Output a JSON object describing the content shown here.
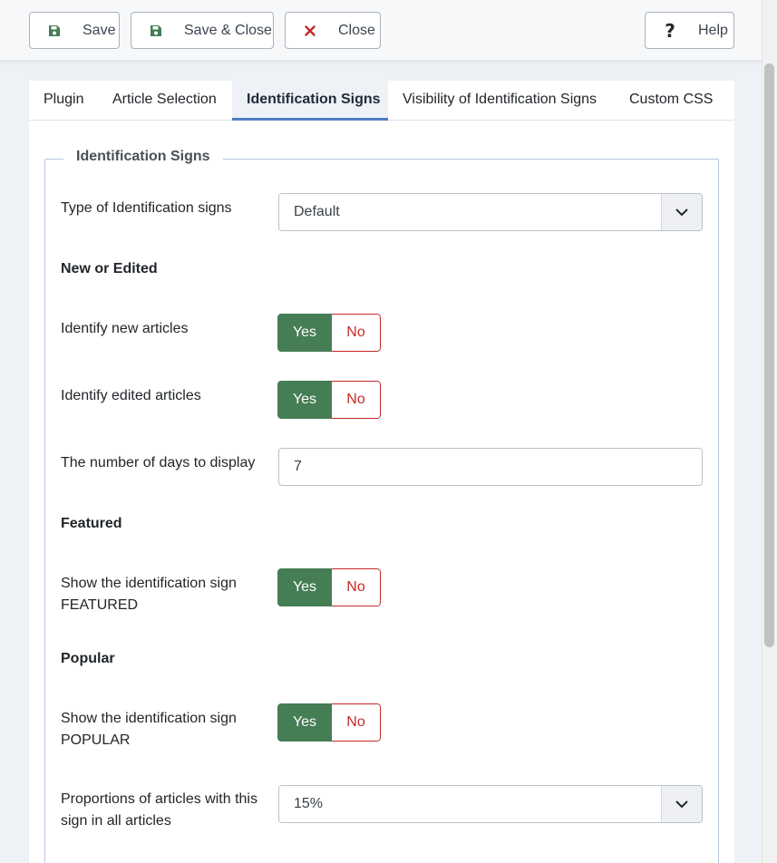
{
  "toolbar": {
    "save_label": "Save",
    "save_close_label": "Save & Close",
    "close_label": "Close",
    "help_label": "Help"
  },
  "tabs": [
    {
      "label": "Plugin",
      "active": false
    },
    {
      "label": "Article Selection",
      "active": false
    },
    {
      "label": "Identification Signs",
      "active": true
    },
    {
      "label": "Visibility of Identification Signs",
      "active": false
    },
    {
      "label": "Custom CSS",
      "active": false
    }
  ],
  "fieldset": {
    "legend": "Identification Signs",
    "type_label": "Type of Identification signs",
    "type_value": "Default",
    "section_new_edited": "New or Edited",
    "identify_new_label": "Identify new articles",
    "identify_edited_label": "Identify edited articles",
    "days_label": "The number of days to display",
    "days_value": "7",
    "section_featured": "Featured",
    "featured_label_line1": "Show the identification sign",
    "featured_label_line2": "FEATURED",
    "section_popular": "Popular",
    "popular_label_line1": "Show the identification sign",
    "popular_label_line2": "POPULAR",
    "proportion_label_line1": "Proportions of articles with this",
    "proportion_label_line2": "sign in all articles",
    "proportion_value": "15%"
  },
  "toggle": {
    "yes": "Yes",
    "no": "No"
  },
  "colors": {
    "yes_active": "#457d54",
    "no_border": "#c52828",
    "tab_active_border": "#4f7ec3"
  }
}
